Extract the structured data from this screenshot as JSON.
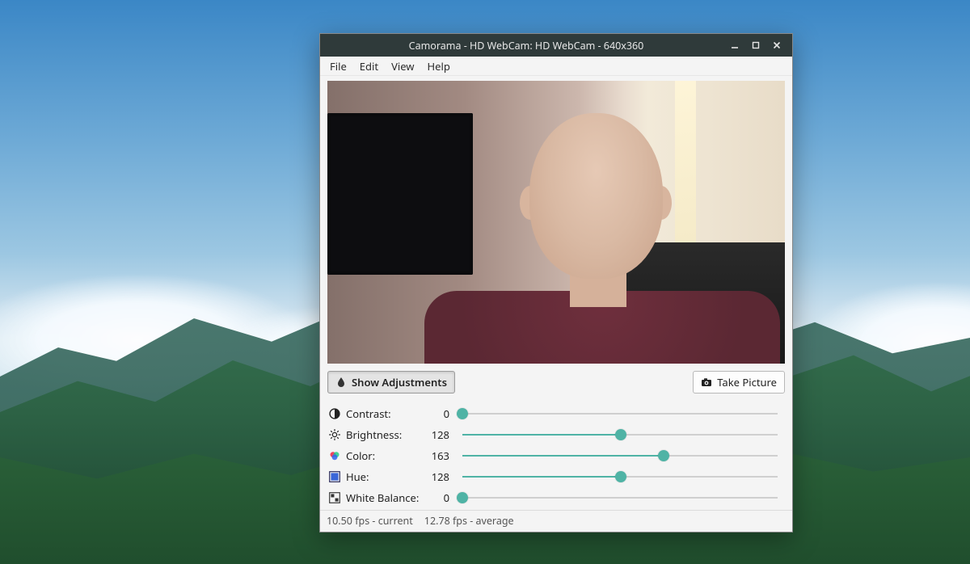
{
  "window": {
    "title": "Camorama - HD WebCam: HD WebCam - 640x360"
  },
  "menubar": {
    "file": "File",
    "edit": "Edit",
    "view": "View",
    "help": "Help"
  },
  "toolbar": {
    "show_adjustments": "Show Adjustments",
    "take_picture": "Take Picture"
  },
  "sliders": {
    "max": 255,
    "contrast": {
      "label": "Contrast:",
      "value": 0
    },
    "brightness": {
      "label": "Brightness:",
      "value": 128
    },
    "color": {
      "label": "Color:",
      "value": 163
    },
    "hue": {
      "label": "Hue:",
      "value": 128
    },
    "white_balance": {
      "label": "White Balance:",
      "value": 0
    }
  },
  "status": {
    "current_fps": "10.50 fps - current",
    "average_fps": "12.78 fps - average"
  }
}
